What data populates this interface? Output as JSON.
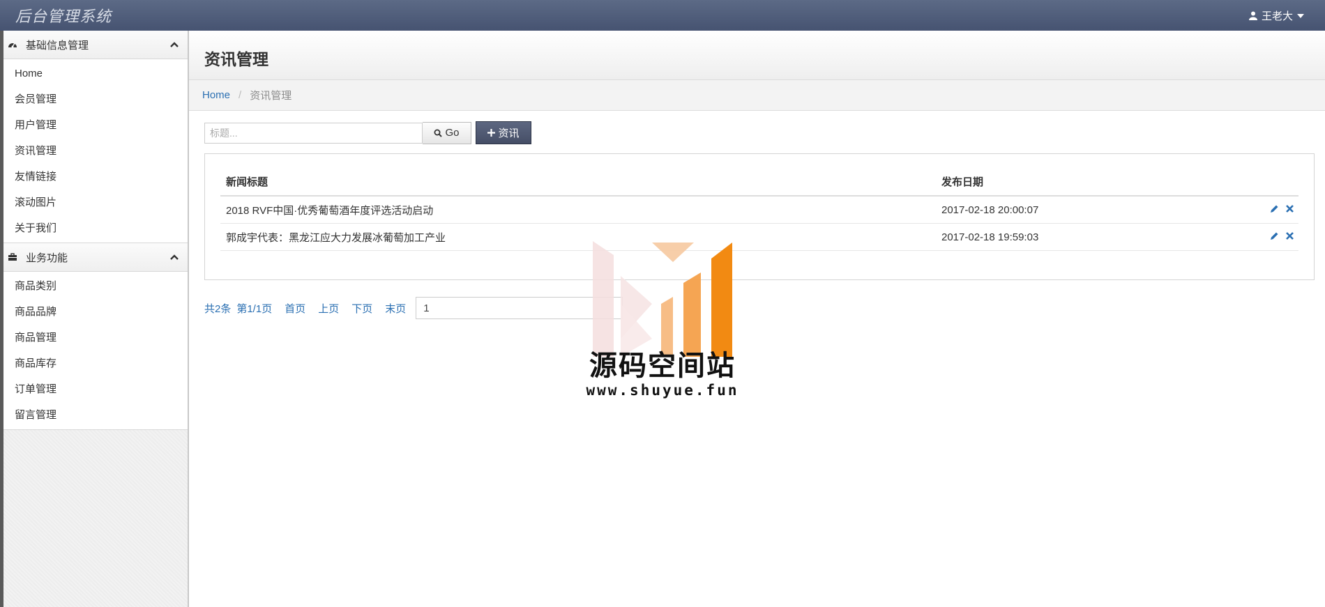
{
  "app": {
    "title": "后台管理系统",
    "user_name": "王老大"
  },
  "sidebar": {
    "groups": [
      {
        "label": "基础信息管理",
        "items": [
          "Home",
          "会员管理",
          "用户管理",
          "资讯管理",
          "友情链接",
          "滚动图片",
          "关于我们"
        ]
      },
      {
        "label": "业务功能",
        "items": [
          "商品类别",
          "商品品牌",
          "商品管理",
          "商品库存",
          "订单管理",
          "留言管理"
        ]
      }
    ]
  },
  "page": {
    "title": "资讯管理",
    "breadcrumb": {
      "home": "Home",
      "current": "资讯管理"
    }
  },
  "toolbar": {
    "search_placeholder": "标题...",
    "go_label": "Go",
    "add_label": "资讯"
  },
  "table": {
    "headers": [
      "新闻标题",
      "发布日期"
    ],
    "rows": [
      {
        "title": "2018 RVF中国·优秀葡萄酒年度评选活动启动",
        "date": "2017-02-18 20:00:07"
      },
      {
        "title": "郭成宇代表：黑龙江应大力发展冰葡萄加工产业",
        "date": "2017-02-18 19:59:03"
      }
    ]
  },
  "pager": {
    "summary": "共2条",
    "page_info": "第1/1页",
    "first": "首页",
    "prev": "上页",
    "next": "下页",
    "last": "末页",
    "page_value": "1"
  },
  "watermark": {
    "title": "源码空间站",
    "url": "www.shuyue.fun"
  },
  "colors": {
    "topbar": "#4f5b79",
    "link": "#2a6fb2",
    "accent_orange": "#f28a12"
  }
}
